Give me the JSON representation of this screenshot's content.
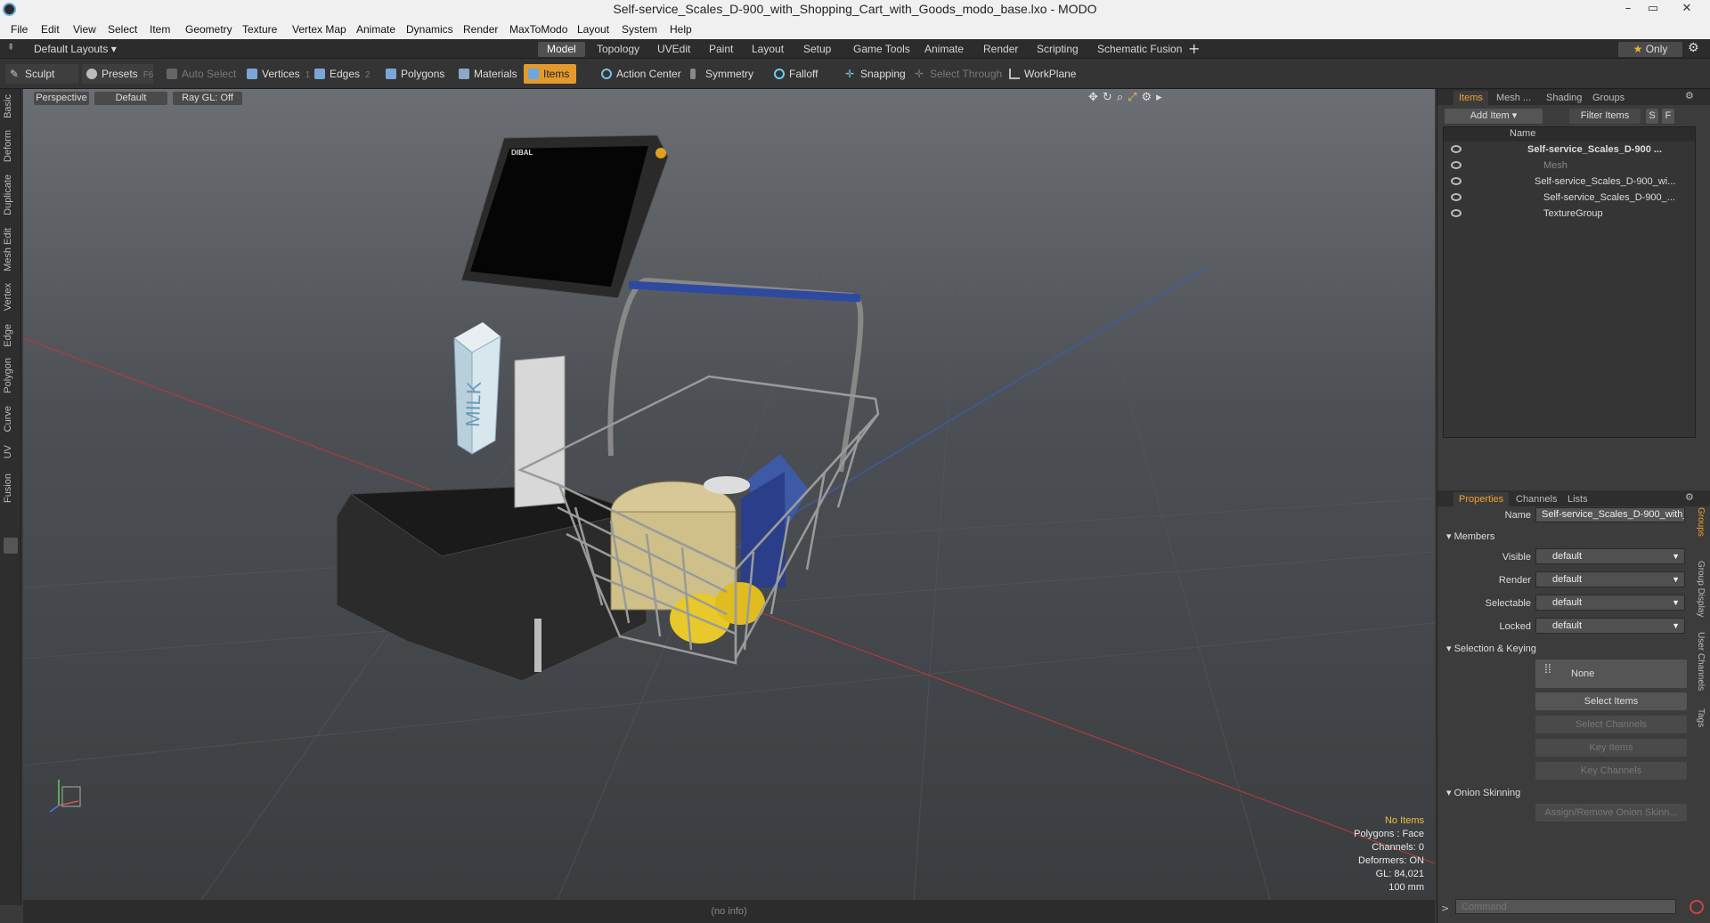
{
  "window": {
    "title": "Self-service_Scales_D-900_with_Shopping_Cart_with_Goods_modo_base.lxo - MODO"
  },
  "menu": [
    "File",
    "Edit",
    "View",
    "Select",
    "Item",
    "Geometry",
    "Texture",
    "Vertex Map",
    "Animate",
    "Dynamics",
    "Render",
    "MaxToModo",
    "Layout",
    "System",
    "Help"
  ],
  "layout": {
    "selector": "Default Layouts",
    "tabs": [
      "Model",
      "Topology",
      "UVEdit",
      "Paint",
      "Layout",
      "Setup",
      "Game Tools",
      "Animate",
      "Render",
      "Scripting",
      "Schematic Fusion"
    ],
    "active_tab": "Model",
    "only_label": "Only"
  },
  "toolbar": {
    "sculpt": "Sculpt",
    "presets": "Presets",
    "presets_key": "F6",
    "auto_select": "Auto Select",
    "vertices": "Vertices",
    "vertices_count": "1",
    "edges": "Edges",
    "edges_count": "2",
    "polygons": "Polygons",
    "materials": "Materials",
    "items": "Items",
    "action_center": "Action Center",
    "symmetry": "Symmetry",
    "falloff": "Falloff",
    "snapping": "Snapping",
    "select_through": "Select Through",
    "workplane": "WorkPlane"
  },
  "left_tabs": [
    "Basic",
    "Deform",
    "Duplicate",
    "Mesh Edit",
    "Vertex",
    "Edge",
    "Polygon",
    "Curve",
    "UV",
    "Fusion"
  ],
  "viewport": {
    "view": "Perspective",
    "shading": "Default",
    "raygl": "Ray GL: Off",
    "info": {
      "items": "No Items",
      "polygons": "Polygons : Face",
      "channels": "Channels: 0",
      "deformers": "Deformers: ON",
      "gl": "GL: 84,021",
      "unit": "100 mm"
    },
    "status": "(no info)",
    "screen_brand": "DIBAL",
    "carton_label": "MILK"
  },
  "items_panel": {
    "tabs": [
      "Items",
      "Mesh ...",
      "Shading",
      "Groups"
    ],
    "add_item": "Add Item",
    "filter": "Filter Items",
    "s_btn": "S",
    "f_btn": "F",
    "col_name": "Name",
    "rows": [
      "Self-service_Scales_D-900 ...",
      "Mesh",
      "Self-service_Scales_D-900_wi...",
      "Self-service_Scales_D-900_...",
      "TextureGroup"
    ]
  },
  "properties_panel": {
    "tabs": [
      "Properties",
      "Channels",
      "Lists"
    ],
    "name_label": "Name",
    "name_value": "Self-service_Scales_D-900_with_",
    "members": "Members",
    "fields": [
      {
        "label": "Visible",
        "value": "default"
      },
      {
        "label": "Render",
        "value": "default"
      },
      {
        "label": "Selectable",
        "value": "default"
      },
      {
        "label": "Locked",
        "value": "default"
      }
    ],
    "selection_keying": "Selection & Keying",
    "none_label": "None",
    "select_items": "Select Items",
    "select_channels": "Select Channels",
    "key_items": "Key Items",
    "key_channels": "Key Channels",
    "onion": "Onion Skinning",
    "assign_onion": "Assign/Remove Onion Skinn...",
    "side_tabs": [
      "Groups",
      "Group Display",
      "User Channels",
      "Tags"
    ]
  },
  "command": {
    "placeholder": "Command"
  },
  "colors": {
    "accent": "#e39a2c",
    "bg": "#3a3a3a"
  }
}
